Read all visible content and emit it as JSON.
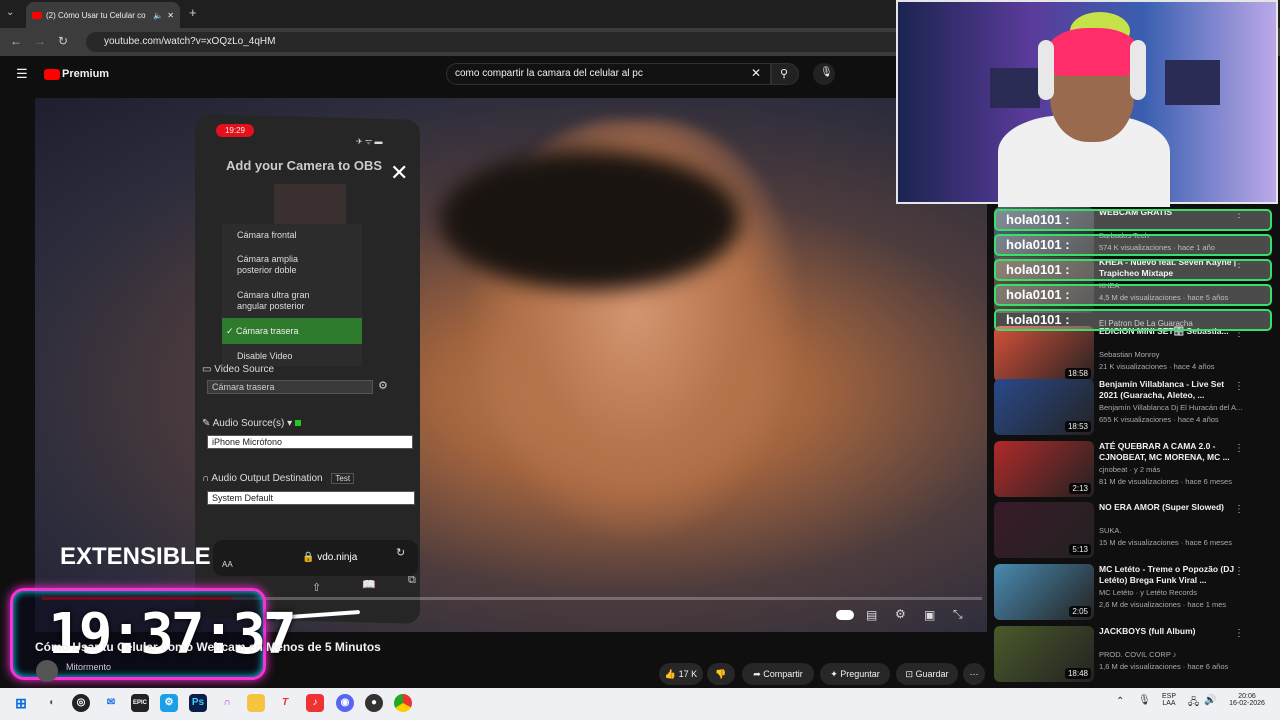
{
  "browser": {
    "tab_title": "(2) Cómo Usar tu Celular co",
    "url": "youtube.com/watch?v=xOQzLo_4qHM"
  },
  "youtube": {
    "logo_text": "Premium",
    "search_value": "como compartir la camara del celular al pc"
  },
  "phone": {
    "time": "19:29",
    "title": "Add your Camera to OBS",
    "menu": [
      "Cámara frontal",
      "Cámara amplia posterior doble",
      "Cámara ultra gran angular posterior",
      "✓ Cámara trasera",
      "Disable Video"
    ],
    "video_source_label": "Video Source",
    "video_source_value": "Cámara trasera",
    "audio_source_label": "Audio Source(s)",
    "audio_source_value": "iPhone Micrófono",
    "audio_output_label": "Audio Output Destination",
    "audio_output_test": "Test",
    "audio_output_value": "System Default",
    "domain": "vdo.ninja",
    "aa": "AA"
  },
  "overlay": {
    "extensible": "EXTENSIBLE",
    "clock": "19:37:37"
  },
  "video": {
    "title": "Cómo Usar tu Celular como Webcam en Menos de 5 Minutos",
    "channel": "Mitormento",
    "likes": "17 K",
    "share": "Compartir",
    "ask": "Preguntar",
    "save": "Guardar"
  },
  "chat": [
    "hola0101 :",
    "hola0101 :",
    "hola0101 :",
    "hola0101 :",
    "hola0101 :"
  ],
  "sidebar": [
    {
      "title": "WEBCAM GRATIS",
      "channel": "Barbados Tech",
      "meta": "574 K visualizaciones · hace 1 año",
      "duration": "",
      "color": "#5a6a7a"
    },
    {
      "title": "KHEA - Nuevo feat. Seven Kayne | Trapicheo Mixtape",
      "channel": "KHEA",
      "meta": "4,5 M de visualizaciones · hace 5 años",
      "duration": "",
      "color": "#6a5a4a"
    },
    {
      "title": "El Patron De La Guaracha",
      "channel": "",
      "meta": "",
      "duration": "",
      "color": "#c85a3a"
    },
    {
      "title": "EDICION MINI SET🎛️ Sebastia...",
      "channel": "Sebastian Monroy",
      "meta": "21 K visualizaciones · hace 4 años",
      "duration": "18:58",
      "color": "#d4503a"
    },
    {
      "title": "Benjamín Villablanca - Live Set 2021 (Guaracha, Aleteo, ...",
      "channel": "Benjamín Villablanca Dj El Huracán del A...",
      "meta": "655 K visualizaciones · hace 4 años",
      "duration": "18:53",
      "color": "#2a4a8a"
    },
    {
      "title": "ATÉ QUEBRAR A CAMA 2.0 - CJNOBEAT, MC MORENA, MC ...",
      "channel": "cjnobeat · y 2 más",
      "meta": "81 M de visualizaciones · hace 6 meses",
      "duration": "2:13",
      "color": "#b02a2a"
    },
    {
      "title": "NO ERA AMOR (Super Slowed)",
      "channel": "SUKA.",
      "meta": "15 M de visualizaciones · hace 6 meses",
      "duration": "5:13",
      "color": "#3a1a2a"
    },
    {
      "title": "MC Letéto - Treme o Popozão (DJ Letéto) Brega Funk Viral ...",
      "channel": "MC Letéto · y Letéto Records",
      "meta": "2,6 M de visualizaciones · hace 1 mes",
      "duration": "2:05",
      "color": "#4a8ab0"
    },
    {
      "title": "JACKBOYS (full Album)",
      "channel": "PROD. COVIL CORP ♪",
      "meta": "1,6 M de visualizaciones · hace 6 años",
      "duration": "18:48",
      "color": "#4a5a2a"
    }
  ],
  "taskbar": {
    "lang": "ESP",
    "lang2": "LAA",
    "time": "20:06",
    "date": "16-02-2026"
  }
}
